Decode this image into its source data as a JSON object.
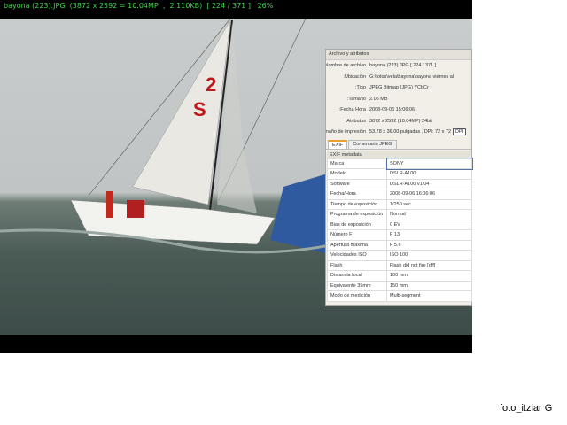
{
  "status_bar": "bayona (223).JPG  (3872 x 2592 = 10.04MP  ,  2.110KB)  [ 224 / 371 ]   26%",
  "panel": {
    "title": "Archivo y atributos",
    "attributes": [
      {
        "label": "Nombre de archivo:",
        "value": "bayona (223).JPG   [ 224 / 371 ]"
      },
      {
        "label": "Ubicación:",
        "value": "G:\\fotos\\vela\\bayona\\bayona viernes al"
      },
      {
        "label": "Tipo:",
        "value": "JPEG Bitmap (JPG) YCbCr"
      },
      {
        "label": "Tamaño:",
        "value": "2.06 MB"
      },
      {
        "label": "Fecha Hora:",
        "value": "2008-09-06 15:06:06"
      },
      {
        "label": "Atributos:",
        "value": "3872 x 2592 (10.04MP)   24bit"
      },
      {
        "label": "Tamaño de impresión:",
        "value": "53.78 x 36.00 pulgadas ,  DPI: 72 x 72"
      }
    ],
    "dpi_button": "DPI",
    "tabs": [
      "EXIF",
      "Comentario JPEG"
    ],
    "exif_header": "EXIF metadata",
    "exif": [
      [
        "Marca",
        "SONY"
      ],
      [
        "Modelo",
        "DSLR-A100"
      ],
      [
        "Software",
        "DSLR-A100 v1.04"
      ],
      [
        "Fecha/Hora",
        "2008-09-06 16:06:06"
      ],
      [
        "Tiempo de exposición",
        "1/250 sec"
      ],
      [
        "Programa de exposición",
        "Normal"
      ],
      [
        "Bias de exposición",
        "0 EV"
      ],
      [
        "Número F",
        "F 13"
      ],
      [
        "Apertura máxima",
        "F 5.6"
      ],
      [
        "Velocidades ISO",
        "ISO 100"
      ],
      [
        "Flash",
        "Flash did not fire [off]"
      ],
      [
        "Distancia focal",
        "100 mm"
      ],
      [
        "Equivalente 35mm",
        "150 mm"
      ],
      [
        "Modo de medición",
        "Multi-segment"
      ]
    ]
  },
  "sail_number": "2 S",
  "credit": "foto_itziar G"
}
